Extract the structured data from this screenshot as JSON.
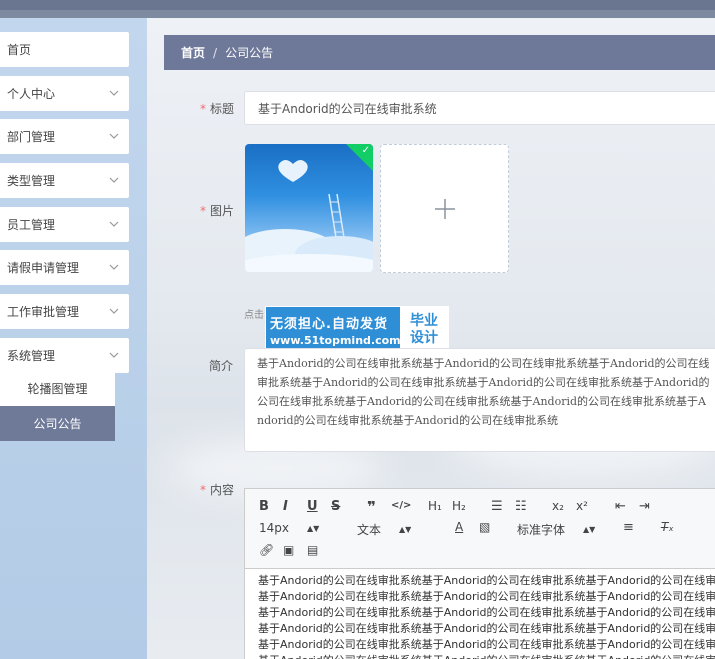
{
  "sidebar": {
    "items": [
      {
        "label": "首页",
        "has_arrow": false
      },
      {
        "label": "个人中心",
        "has_arrow": true
      },
      {
        "label": "部门管理",
        "has_arrow": true
      },
      {
        "label": "类型管理",
        "has_arrow": true
      },
      {
        "label": "员工管理",
        "has_arrow": true
      },
      {
        "label": "请假申请管理",
        "has_arrow": true
      },
      {
        "label": "工作审批管理",
        "has_arrow": true
      },
      {
        "label": "系统管理",
        "has_arrow": true
      }
    ],
    "submenu": [
      {
        "label": "轮播图管理",
        "active": false
      },
      {
        "label": "公司公告",
        "active": true
      }
    ]
  },
  "breadcrumb": {
    "home": "首页",
    "separator": "/",
    "current": "公司公告"
  },
  "form": {
    "title_label": "标题",
    "title_value": "基于Andorid的公司在线审批系统",
    "image_label": "图片",
    "upload_hint": "点击",
    "intro_label": "简介",
    "intro_value": "基于Andorid的公司在线审批系统基于Andorid的公司在线审批系统基于Andorid的公司在线审批系统基于Andorid的公司在线审批系统基于Andorid的公司在线审批系统基于Andorid的公司在线审批系统基于Andorid的公司在线审批系统基于Andorid的公司在线审批系统基于Andorid的公司在线审批系统基于Andorid的公司在线审批系统",
    "content_label": "内容"
  },
  "watermark": {
    "line1": "无须担心.自动发货",
    "line2": "www.51topmind.com",
    "right1": "毕业",
    "right2": "设计"
  },
  "editor": {
    "font_size": "14px",
    "paragraph": "文本",
    "font_family": "标准字体",
    "body_line": "基于Andorid的公司在线审批系统基于Andorid的公司在线审批系统基于Andorid的公司在线审批系统基于Andorid的公司在线审批系统"
  },
  "colors": {
    "accent": "#6e7899",
    "sidebar_bg": "#bdd3ea",
    "success": "#13ce66",
    "required": "#f56c6c"
  }
}
